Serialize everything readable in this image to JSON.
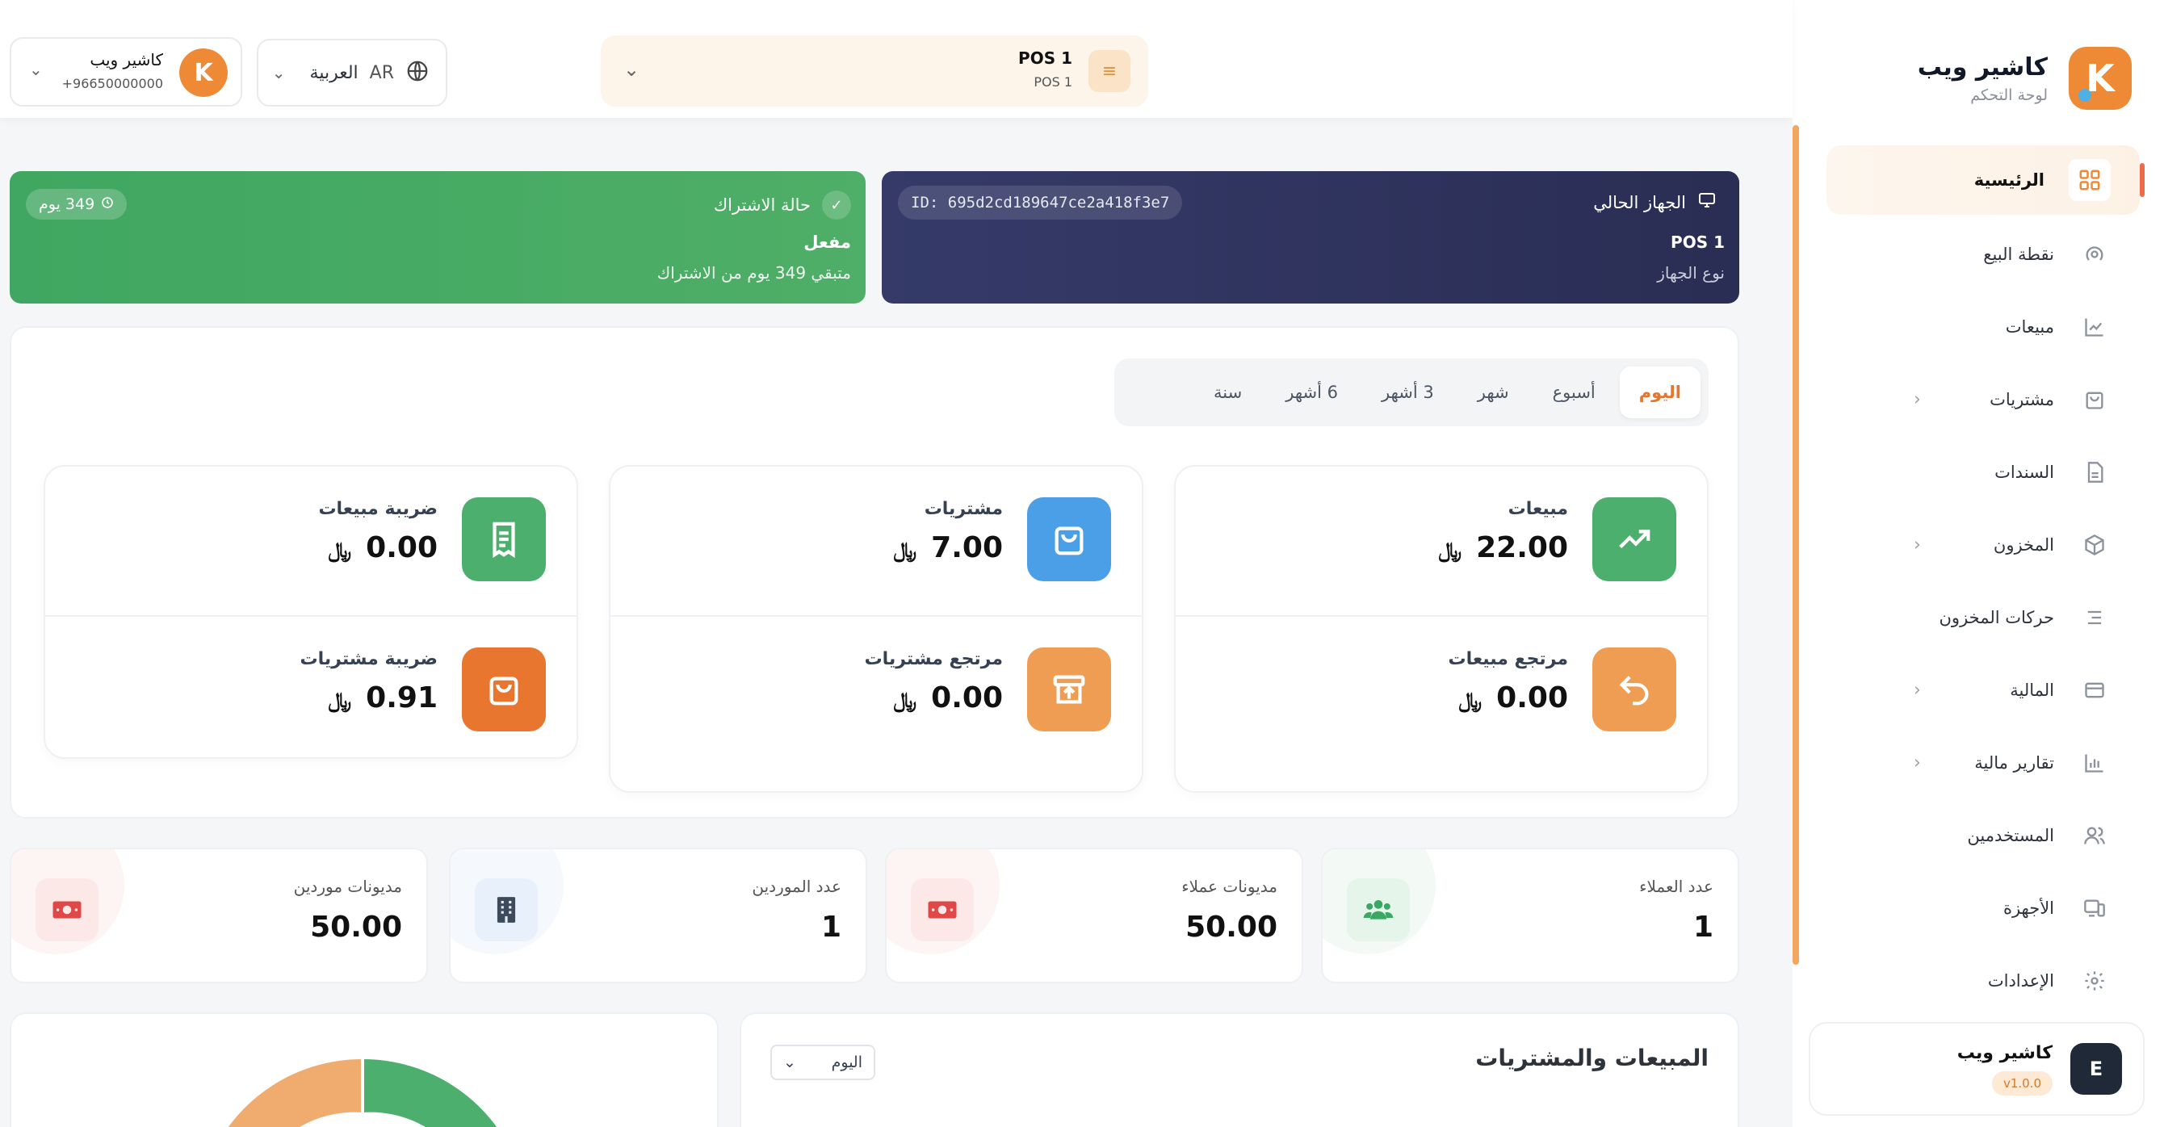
{
  "brand": {
    "title": "كاشير ويب",
    "subtitle": "لوحة التحكم",
    "logo_letter": "K"
  },
  "sidebar": {
    "items": [
      {
        "label": "الرئيسية",
        "icon": "grid-icon",
        "active": true
      },
      {
        "label": "نقطة البيع",
        "icon": "pos-icon"
      },
      {
        "label": "مبيعات",
        "icon": "chart-line-icon"
      },
      {
        "label": "مشتريات",
        "icon": "shopping-bag-icon",
        "has_children": true
      },
      {
        "label": "السندات",
        "icon": "document-icon"
      },
      {
        "label": "المخزون",
        "icon": "box-icon",
        "has_children": true
      },
      {
        "label": "حركات المخزون",
        "icon": "list-icon"
      },
      {
        "label": "المالية",
        "icon": "card-icon",
        "has_children": true
      },
      {
        "label": "تقارير مالية",
        "icon": "bar-chart-icon",
        "has_children": true
      },
      {
        "label": "المستخدمين",
        "icon": "users-icon"
      },
      {
        "label": "الأجهزة",
        "icon": "devices-icon"
      },
      {
        "label": "الإعدادات",
        "icon": "settings-icon"
      }
    ],
    "user": {
      "name": "كاشير ويب",
      "initial": "E",
      "version": "v1.0.0"
    }
  },
  "topbar": {
    "pos": {
      "title": "POS 1",
      "subtitle": "POS 1"
    },
    "language": {
      "code": "AR",
      "name": "العربية"
    },
    "account": {
      "name": "كاشير ويب",
      "phone": "+96650000000"
    }
  },
  "device": {
    "heading": "الجهاز الحالي",
    "name": "POS 1",
    "type_label": "نوع الجهاز",
    "id": "ID: 695d2cd189647ce2a418f3e7"
  },
  "subscription": {
    "heading": "حالة الاشتراك",
    "status": "مفعل",
    "remaining_text": "متبقي 349 يوم من الاشتراك",
    "days_pill": "349 يوم"
  },
  "period_tabs": [
    "اليوم",
    "أسبوع",
    "شهر",
    "3 أشهر",
    "6 أشهر",
    "سنة"
  ],
  "active_tab": "اليوم",
  "currency_symbol": "﷼",
  "stats": {
    "sales": {
      "label": "مبيعات",
      "value": "22.00"
    },
    "sales_return": {
      "label": "مرتجع مبيعات",
      "value": "0.00"
    },
    "purchases": {
      "label": "مشتريات",
      "value": "7.00"
    },
    "purchases_return": {
      "label": "مرتجع مشتريات",
      "value": "0.00"
    },
    "sales_tax": {
      "label": "ضريبة مبيعات",
      "value": "0.00"
    },
    "purchases_tax": {
      "label": "ضريبة مشتريات",
      "value": "0.91"
    }
  },
  "mini_cards": {
    "customers_count": {
      "label": "عدد العملاء",
      "value": "1"
    },
    "customers_debts": {
      "label": "مديونات عملاء",
      "value": "50.00"
    },
    "suppliers_count": {
      "label": "عدد الموردين",
      "value": "1"
    },
    "suppliers_debts": {
      "label": "مديونات موردين",
      "value": "50.00"
    }
  },
  "sales_chart": {
    "title": "المبيعات والمشتريات",
    "period": "اليوم"
  },
  "colors": {
    "accent": "#ee8a35",
    "green": "#4caf6e",
    "navy": "#2f3360",
    "blue": "#4a9fe6",
    "orange_strong": "#e8762e",
    "orange_soft": "#ef9d52"
  }
}
